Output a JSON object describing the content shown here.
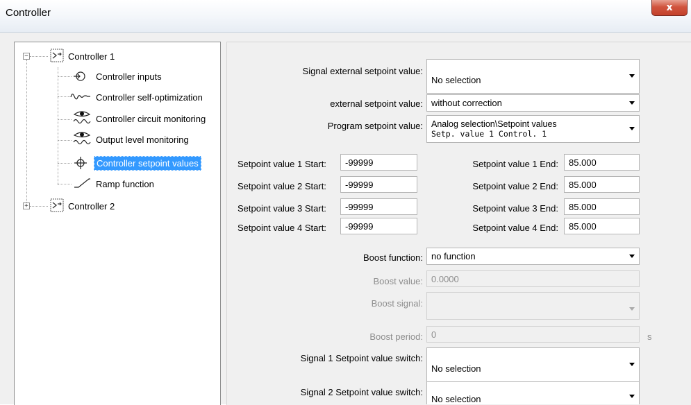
{
  "window": {
    "title": "Controller",
    "close_glyph": "x"
  },
  "tree": {
    "controller1": "Controller 1",
    "children": [
      {
        "label": "Controller inputs",
        "icon": "controller-inputs-icon"
      },
      {
        "label": "Controller self-optimization",
        "icon": "self-optimization-icon"
      },
      {
        "label": "Controller circuit monitoring",
        "icon": "circuit-monitoring-icon"
      },
      {
        "label": "Output level monitoring",
        "icon": "output-monitoring-icon"
      },
      {
        "label": "Controller setpoint values",
        "icon": "setpoint-values-icon",
        "selected": true
      },
      {
        "label": "Ramp function",
        "icon": "ramp-function-icon"
      }
    ],
    "controller2": "Controller 2",
    "expanded_glyph": "−",
    "collapsed_glyph": "+",
    "selection_color": "#3399ff"
  },
  "form": {
    "signal_ext_label": "Signal external setpoint value:",
    "signal_ext_value": "No selection",
    "ext_label": "external setpoint value:",
    "ext_value": "without correction",
    "program_label": "Program setpoint value:",
    "program_line1": "Analog selection\\Setpoint values",
    "program_line2": "Setp. value 1 Control. 1",
    "setpoints": [
      {
        "start_label": "Setpoint value 1 Start:",
        "start": "-99999",
        "end_label": "Setpoint value 1 End:",
        "end": "85.000"
      },
      {
        "start_label": "Setpoint value 2 Start:",
        "start": "-99999",
        "end_label": "Setpoint value 2 End:",
        "end": "85.000"
      },
      {
        "start_label": "Setpoint value 3 Start:",
        "start": "-99999",
        "end_label": "Setpoint value 3 End:",
        "end": "85.000"
      },
      {
        "start_label": "Setpoint value 4 Start:",
        "start": "-99999",
        "end_label": "Setpoint value 4 End:",
        "end": "85.000"
      }
    ],
    "boost_function_label": "Boost function:",
    "boost_function_value": "no function",
    "boost_value_label": "Boost value:",
    "boost_value": "0.0000",
    "boost_signal_label": "Boost signal:",
    "boost_signal_value": "",
    "boost_period_label": "Boost period:",
    "boost_period_value": "0",
    "boost_period_unit": "s",
    "signal1_label": "Signal 1 Setpoint value switch:",
    "signal1_value": "No selection",
    "signal2_label": "Signal 2 Setpoint value switch:",
    "signal2_value": "No selection"
  }
}
